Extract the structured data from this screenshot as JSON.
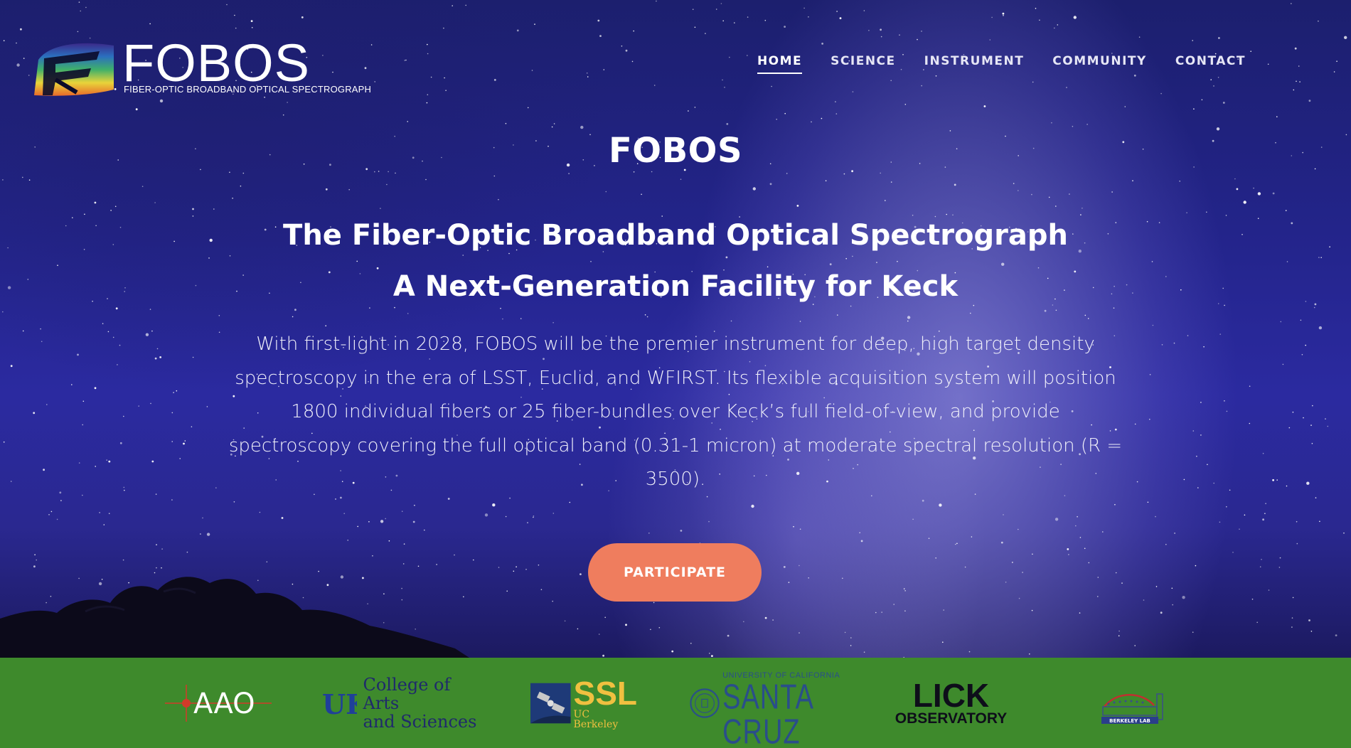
{
  "header": {
    "logo_title": "FOBOS",
    "logo_subtitle": "FIBER-OPTIC BROADBAND OPTICAL SPECTROGRAPH"
  },
  "nav": {
    "items": [
      {
        "label": "HOME",
        "active": true
      },
      {
        "label": "SCIENCE",
        "active": false
      },
      {
        "label": "INSTRUMENT",
        "active": false
      },
      {
        "label": "COMMUNITY",
        "active": false
      },
      {
        "label": "CONTACT",
        "active": false
      }
    ]
  },
  "hero": {
    "title": "FOBOS",
    "subtitle_line1": "The Fiber-Optic Broadband Optical Spectrograph",
    "subtitle_line2": "A Next-Generation Facility for Keck",
    "description": "With first-light in 2028, FOBOS will be the premier instrument for deep, high target density spectroscopy in the era of LSST, Euclid, and WFIRST. Its flexible acquisition system will position 1800 individual fibers or 25 fiber-bundles over Keck’s full field-of-view, and provide spectroscopy covering the full optical band (0.31-1 micron) at moderate spectral resolution (R = 3500).",
    "cta_label": "PARTICIPATE"
  },
  "partners": {
    "aao": {
      "text": "AAO",
      "icon": "crosshair-icon"
    },
    "uk": {
      "mark": "UK",
      "line1": "College of Arts",
      "line2": "and Sciences"
    },
    "ssl": {
      "text": "SSL",
      "sub": "UC Berkeley",
      "icon": "satellite-icon"
    },
    "ucsc": {
      "line1": "UNIVERSITY OF CALIFORNIA",
      "line2": "SANTA CRUZ",
      "icon": "seal-icon"
    },
    "lick": {
      "line1": "LICK",
      "line2": "OBSERVATORY"
    },
    "berkeley_lab": {
      "text": "BERKELEY LAB",
      "icon": "building-icon"
    }
  },
  "colors": {
    "accent": "#ef7d5e",
    "partner_strip": "#3e8a2c",
    "sky_dark": "#1c1f6e",
    "text": "#ffffff"
  }
}
